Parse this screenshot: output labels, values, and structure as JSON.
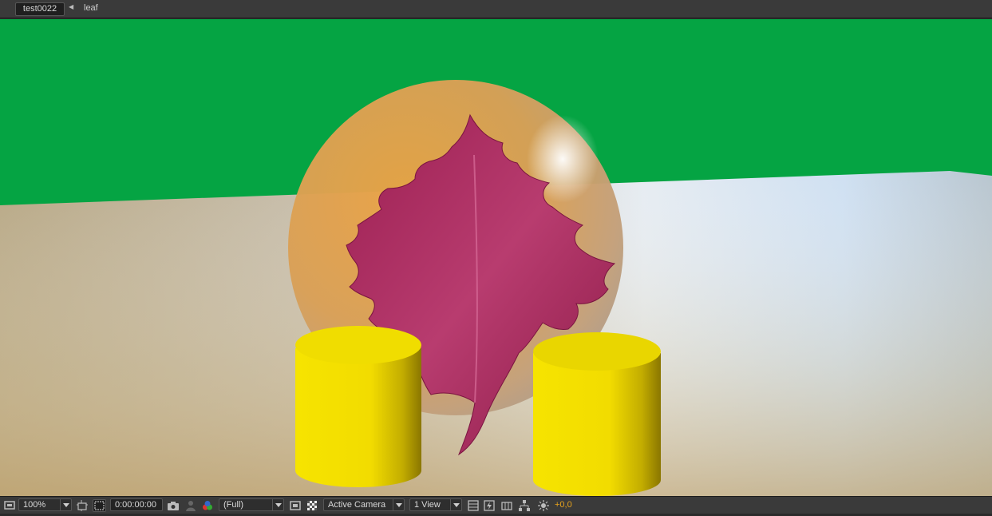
{
  "breadcrumb": {
    "active": "test0022",
    "item": "leaf"
  },
  "toolbar": {
    "zoom": "100%",
    "timecode": "0:00:00:00",
    "resolution": "(Full)",
    "camera": "Active Camera",
    "views": "1 View",
    "exposure": "+0,0"
  },
  "colors": {
    "background_green": "#05a443",
    "cylinder_yellow": "#f3dd00",
    "leaf_magenta": "#b0245c",
    "exposure_orange": "#e7a21c"
  },
  "icons": [
    "monitor-icon",
    "region-icon",
    "transparency-grid-icon",
    "snapshot-icon",
    "show-snapshot-icon",
    "channel-icon",
    "region-of-interest-icon",
    "checkerboard-icon",
    "fast-preview-icon",
    "timeline-icon",
    "flowchart-icon",
    "exposure-icon"
  ]
}
